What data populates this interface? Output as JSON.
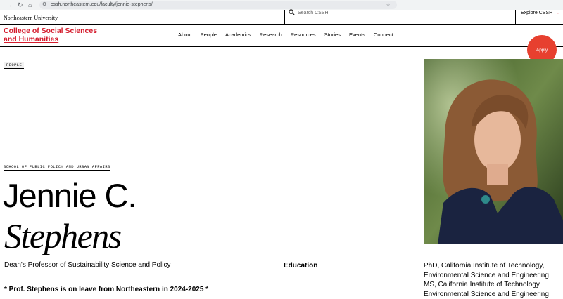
{
  "browser": {
    "url": "cssh.northeastern.edu/faculty/jennie-stephens/"
  },
  "top_bar": {
    "university": "Northeastern University",
    "search_placeholder": "Search CSSH",
    "explore_label": "Explore CSSH",
    "explore_arrow": "→"
  },
  "header": {
    "college_line1": "College of Social Sciences",
    "college_line2": "and Humanities",
    "nav": [
      "About",
      "People",
      "Academics",
      "Research",
      "Resources",
      "Stories",
      "Events",
      "Connect"
    ],
    "apply_label": "Apply"
  },
  "profile": {
    "category_tag": "PEOPLE",
    "school_tag": "SCHOOL OF PUBLIC POLICY AND URBAN AFFAIRS",
    "first_name": "Jennie C.",
    "last_name": "Stephens",
    "title": "Dean's Professor of Sustainability Science and Policy",
    "leave_notice": "* Prof. Stephens is on leave from Northeastern in 2024-2025 *"
  },
  "education": {
    "heading": "Education",
    "lines": [
      "PhD, California Institute of Technology,",
      "Environmental Science and Engineering",
      "MS, California Institute of Technology,",
      "Environmental Science and Engineering"
    ]
  },
  "colors": {
    "brand_red": "#d41b2c",
    "apply_red": "#e7402f"
  },
  "icons": {
    "back": "arrow-right-icon",
    "reload": "reload-icon",
    "home": "home-icon",
    "site_settings": "tune-icon",
    "bookmark": "star-icon",
    "search": "search-icon"
  }
}
